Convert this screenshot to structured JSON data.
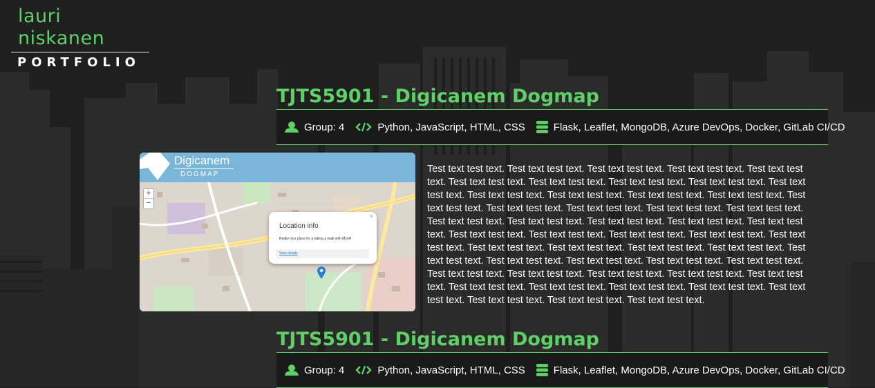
{
  "site": {
    "name": "lauri niskanen",
    "subtitle": "PORTFOLIO"
  },
  "colors": {
    "accent": "#5fd068",
    "background": "#1f1f1f",
    "skyline": "#2c2c2c"
  },
  "projects": [
    {
      "title": "TJTS5901 - Digicanem Dogmap",
      "group": "Group: 4",
      "languages": "Python, JavaScript, HTML, CSS",
      "stack": "Flask, Leaflet, MongoDB, Azure DevOps, Docker, GitLab CI/CD",
      "icons": [
        "user-icon",
        "code-icon",
        "database-icon"
      ],
      "screenshot": {
        "brand": "Digicanem",
        "brand_sub": "DOGMAP",
        "zoom_in": "+",
        "zoom_out": "−",
        "popup_close": "×",
        "popup_title": "Location info",
        "popup_text": "Really nice place for a taking a walk with Myoll!",
        "popup_link": "View details"
      },
      "description": "Test text test text. Test text test text. Test text test text. Test text test text. Test text test text. Test text test text. Test text test text. Test text test text. Test text test text. Test text test text. Test text test text. Test text test text. Test text test text. Test text test text. Test text test text. Test text test text. Test text test text. Test text test text. Test text test text. Test text test text. Test text test text. Test text test text. Test text test text. Test text test text. Test text test text. Test text test text. Test text test text. Test text test text. Test text test text. Test text test text. Test text test text. Test text test text. Test text test text. Test text test text. Test text test text. Test text test text. Test text test text. Test text test text. Test text test text. Test text test text. Test text test text. Test text test text. Test text test text. Test text test text. Test text test text. Test text test text. Test text test text. Test text test text. Test text test text. Test text test text. Test text test text."
    },
    {
      "title": "TJTS5901 - Digicanem Dogmap",
      "group": "Group: 4",
      "languages": "Python, JavaScript, HTML, CSS",
      "stack": "Flask, Leaflet, MongoDB, Azure DevOps, Docker, GitLab CI/CD",
      "icons": [
        "user-icon",
        "code-icon",
        "database-icon"
      ]
    }
  ]
}
